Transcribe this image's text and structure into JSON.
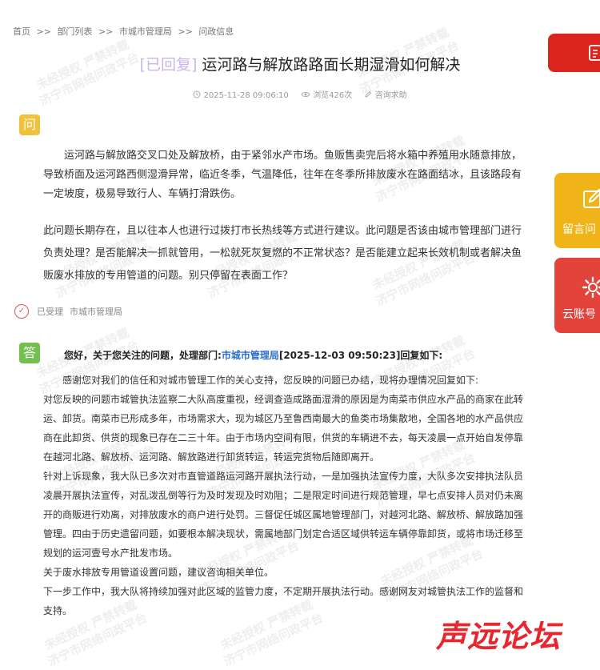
{
  "breadcrumb": {
    "items": [
      "首页",
      ">>",
      "部门列表",
      ">>",
      "市城市管理局",
      ">>",
      "问政信息"
    ]
  },
  "title": {
    "tag": "[已回复]",
    "text": "运河路与解放路路面长期湿滑如何解决"
  },
  "meta": {
    "datetime": "2025-11-28 09:06:10",
    "views": "浏览426次",
    "category": "咨询求助"
  },
  "question": {
    "badge": "问",
    "paragraphs": [
      "运河路与解放路交叉口处及解放桥，由于紧邻水产市场。鱼贩售卖完后将水箱中养殖用水随意排放，导致桥面及运河路西侧湿滑异常，临近冬季，气温降低，往年在冬季所排放废水在路面结冰，且该路段有一定坡度，极易导致行人、车辆打滑跌伤。",
      "此问题长期存在，且以往本人也进行过拨打市长热线等方式进行建议。此问题是否该由城市管理部门进行负责处理？是否能解决一抓就管用，一松就死灰复燃的不正常状态？是否能建立起来长效机制或者解决鱼贩废水排放的专用管道的问题。别只停留在表面工作？"
    ]
  },
  "status": {
    "icon": "check-circle-icon",
    "label": "已受理",
    "dept": "市城市管理局"
  },
  "answer": {
    "badge": "答",
    "head_prefix": "您好，关于您关注的问题，处理部门:",
    "head_dept": "市城市管理局",
    "head_suffix": "[2025-12-03 09:50:23]回复如下:",
    "paragraphs": [
      "感谢您对我们的信任和对城市管理工作的关心支持，您反映的问题已办结，现将办理情况回复如下:",
      "对您反映的问题市城管执法监察二大队高度重视，经调查造成路面湿滑的原因是为南菜市供应水产品的商家在此转运、卸货。南菜市已形成多年，市场需求大，现为城区乃至鲁西南最大的鱼类市场集散地，全国各地的水产品供应商在此卸货、供货的现象已存在二三十年。由于市场内空间有限，供货的车辆进不去，每天凌晨一点开始自发停靠在越河北路、解放桥、运河路、解放路进行卸货转运，转运完货物后随即离开。",
      "针对上诉现象，我大队已多次对市直管道路运河路开展执法行动，一是加强执法宣传力度，大队多次安排执法队员凌晨开展执法宣传，对乱泼乱倒等行为及时发现及时劝阻；二是限定时间进行规范管理，早七点安排人员对仍未离开的商贩进行劝离，对排放废水的商户进行处罚。三督促任城区属地管理部门，对越河北路、解放桥、解放路加强管理。四由于历史遗留问题，如要根本解决现状，需属地部门划定合适区域供转运车辆停靠卸货，或将市场迁移至规划的运河壹号水产批发市场。",
      "关于废水排放专用管道设置问题，建议咨询相关单位。",
      "下一步工作中，我大队将持续加强对此区域的监管力度，不定期开展执法行动。感谢网友对城管执法工作的监督和支持。"
    ]
  },
  "sidebar": {
    "top_icon": "document-icon",
    "message": {
      "icon": "edit-icon",
      "label": "留言问"
    },
    "account": {
      "icon": "gear-icon",
      "label": "云账号"
    }
  },
  "watermark": {
    "line1": "未经授权  严禁转载",
    "line2": "济宁市网络问政平台"
  },
  "logo": {
    "text": "声远论坛"
  },
  "colors": {
    "accent": "#2a6fc9",
    "question_badge": "#f0c13a",
    "answer_badge": "#73bf4f",
    "red": "#e2433a",
    "yellow": "#f0b418"
  }
}
